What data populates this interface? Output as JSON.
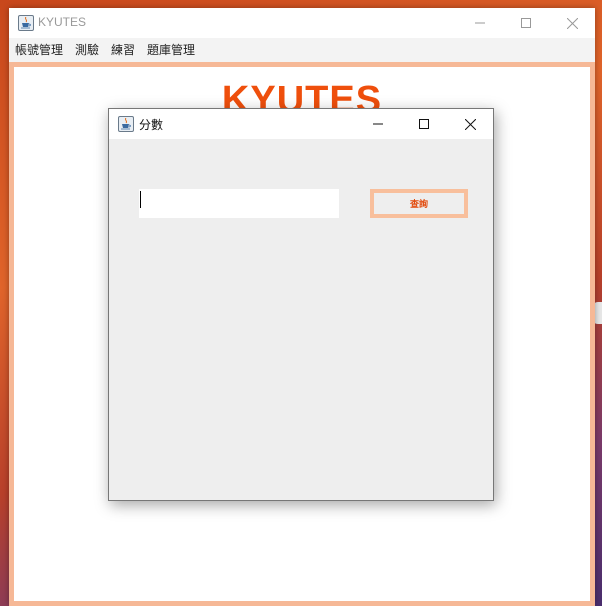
{
  "main_window": {
    "title": "KYUTES",
    "menu": [
      "帳號管理",
      "測驗",
      "練習",
      "題庫管理"
    ],
    "banner": "KYUTES"
  },
  "dialog": {
    "title": "分數",
    "input_value": "",
    "query_label": "查詢"
  },
  "colors": {
    "accent": "#ef4f0c",
    "frame_border": "#f6b896",
    "button_border": "#f8bf9c"
  },
  "icons": {
    "app": "java-cup-icon",
    "minimize": "minimize-icon",
    "maximize": "maximize-icon",
    "close": "close-icon"
  }
}
